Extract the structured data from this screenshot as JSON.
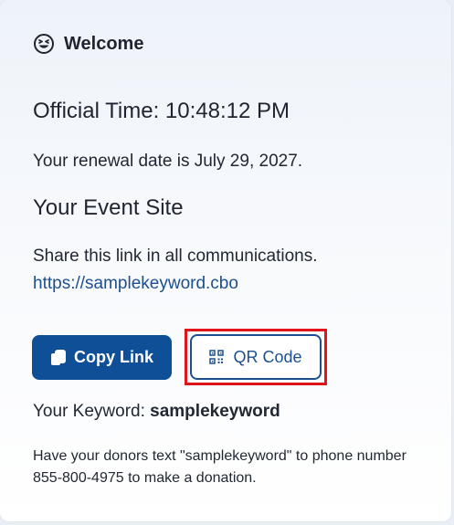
{
  "welcome": {
    "title": "Welcome",
    "icon": "grinning-squint-face-icon"
  },
  "official_time": {
    "label": "Official Time: 10:48:12 PM"
  },
  "renewal": {
    "text": "Your renewal date is July 29, 2027."
  },
  "event_site": {
    "heading": "Your Event Site",
    "share_text": "Share this link in all communications.",
    "link_text": "https://samplekeyword.cbo"
  },
  "buttons": {
    "copy_link_label": "Copy Link",
    "copy_link_icon": "copy-icon",
    "qr_code_label": "QR Code",
    "qr_code_icon": "qr-code-icon"
  },
  "keyword": {
    "label": "Your Keyword: ",
    "value": "samplekeyword"
  },
  "donor_instructions": {
    "text": "Have your donors text \"samplekeyword\" to phone number 855-800-4975 to make a donation."
  },
  "colors": {
    "primary": "#0f4f97",
    "link": "#1d4f8f",
    "highlight": "#e0141a",
    "text": "#222833"
  }
}
